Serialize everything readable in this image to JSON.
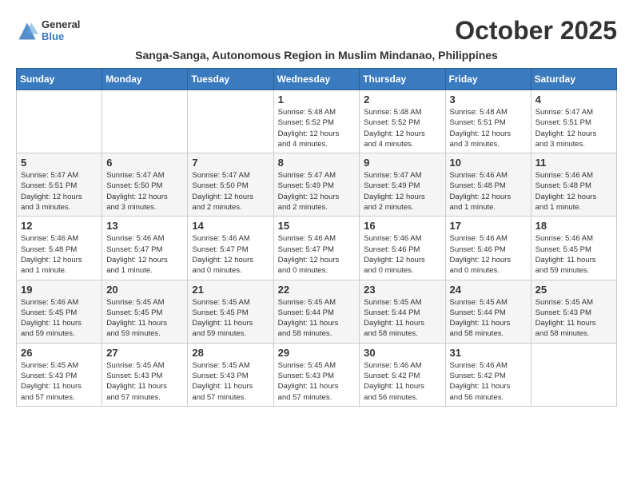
{
  "logo": {
    "general": "General",
    "blue": "Blue"
  },
  "title": "October 2025",
  "subtitle": "Sanga-Sanga, Autonomous Region in Muslim Mindanao, Philippines",
  "headers": [
    "Sunday",
    "Monday",
    "Tuesday",
    "Wednesday",
    "Thursday",
    "Friday",
    "Saturday"
  ],
  "weeks": [
    [
      {
        "day": "",
        "info": ""
      },
      {
        "day": "",
        "info": ""
      },
      {
        "day": "",
        "info": ""
      },
      {
        "day": "1",
        "info": "Sunrise: 5:48 AM\nSunset: 5:52 PM\nDaylight: 12 hours\nand 4 minutes."
      },
      {
        "day": "2",
        "info": "Sunrise: 5:48 AM\nSunset: 5:52 PM\nDaylight: 12 hours\nand 4 minutes."
      },
      {
        "day": "3",
        "info": "Sunrise: 5:48 AM\nSunset: 5:51 PM\nDaylight: 12 hours\nand 3 minutes."
      },
      {
        "day": "4",
        "info": "Sunrise: 5:47 AM\nSunset: 5:51 PM\nDaylight: 12 hours\nand 3 minutes."
      }
    ],
    [
      {
        "day": "5",
        "info": "Sunrise: 5:47 AM\nSunset: 5:51 PM\nDaylight: 12 hours\nand 3 minutes."
      },
      {
        "day": "6",
        "info": "Sunrise: 5:47 AM\nSunset: 5:50 PM\nDaylight: 12 hours\nand 3 minutes."
      },
      {
        "day": "7",
        "info": "Sunrise: 5:47 AM\nSunset: 5:50 PM\nDaylight: 12 hours\nand 2 minutes."
      },
      {
        "day": "8",
        "info": "Sunrise: 5:47 AM\nSunset: 5:49 PM\nDaylight: 12 hours\nand 2 minutes."
      },
      {
        "day": "9",
        "info": "Sunrise: 5:47 AM\nSunset: 5:49 PM\nDaylight: 12 hours\nand 2 minutes."
      },
      {
        "day": "10",
        "info": "Sunrise: 5:46 AM\nSunset: 5:48 PM\nDaylight: 12 hours\nand 1 minute."
      },
      {
        "day": "11",
        "info": "Sunrise: 5:46 AM\nSunset: 5:48 PM\nDaylight: 12 hours\nand 1 minute."
      }
    ],
    [
      {
        "day": "12",
        "info": "Sunrise: 5:46 AM\nSunset: 5:48 PM\nDaylight: 12 hours\nand 1 minute."
      },
      {
        "day": "13",
        "info": "Sunrise: 5:46 AM\nSunset: 5:47 PM\nDaylight: 12 hours\nand 1 minute."
      },
      {
        "day": "14",
        "info": "Sunrise: 5:46 AM\nSunset: 5:47 PM\nDaylight: 12 hours\nand 0 minutes."
      },
      {
        "day": "15",
        "info": "Sunrise: 5:46 AM\nSunset: 5:47 PM\nDaylight: 12 hours\nand 0 minutes."
      },
      {
        "day": "16",
        "info": "Sunrise: 5:46 AM\nSunset: 5:46 PM\nDaylight: 12 hours\nand 0 minutes."
      },
      {
        "day": "17",
        "info": "Sunrise: 5:46 AM\nSunset: 5:46 PM\nDaylight: 12 hours\nand 0 minutes."
      },
      {
        "day": "18",
        "info": "Sunrise: 5:46 AM\nSunset: 5:45 PM\nDaylight: 11 hours\nand 59 minutes."
      }
    ],
    [
      {
        "day": "19",
        "info": "Sunrise: 5:46 AM\nSunset: 5:45 PM\nDaylight: 11 hours\nand 59 minutes."
      },
      {
        "day": "20",
        "info": "Sunrise: 5:45 AM\nSunset: 5:45 PM\nDaylight: 11 hours\nand 59 minutes."
      },
      {
        "day": "21",
        "info": "Sunrise: 5:45 AM\nSunset: 5:45 PM\nDaylight: 11 hours\nand 59 minutes."
      },
      {
        "day": "22",
        "info": "Sunrise: 5:45 AM\nSunset: 5:44 PM\nDaylight: 11 hours\nand 58 minutes."
      },
      {
        "day": "23",
        "info": "Sunrise: 5:45 AM\nSunset: 5:44 PM\nDaylight: 11 hours\nand 58 minutes."
      },
      {
        "day": "24",
        "info": "Sunrise: 5:45 AM\nSunset: 5:44 PM\nDaylight: 11 hours\nand 58 minutes."
      },
      {
        "day": "25",
        "info": "Sunrise: 5:45 AM\nSunset: 5:43 PM\nDaylight: 11 hours\nand 58 minutes."
      }
    ],
    [
      {
        "day": "26",
        "info": "Sunrise: 5:45 AM\nSunset: 5:43 PM\nDaylight: 11 hours\nand 57 minutes."
      },
      {
        "day": "27",
        "info": "Sunrise: 5:45 AM\nSunset: 5:43 PM\nDaylight: 11 hours\nand 57 minutes."
      },
      {
        "day": "28",
        "info": "Sunrise: 5:45 AM\nSunset: 5:43 PM\nDaylight: 11 hours\nand 57 minutes."
      },
      {
        "day": "29",
        "info": "Sunrise: 5:45 AM\nSunset: 5:43 PM\nDaylight: 11 hours\nand 57 minutes."
      },
      {
        "day": "30",
        "info": "Sunrise: 5:46 AM\nSunset: 5:42 PM\nDaylight: 11 hours\nand 56 minutes."
      },
      {
        "day": "31",
        "info": "Sunrise: 5:46 AM\nSunset: 5:42 PM\nDaylight: 11 hours\nand 56 minutes."
      },
      {
        "day": "",
        "info": ""
      }
    ]
  ]
}
